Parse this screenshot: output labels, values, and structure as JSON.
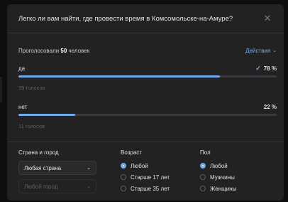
{
  "dialog": {
    "title": "Легко ли вам найти, где провести время в Комсомольске-на-Амуре?",
    "close_icon": "close-icon"
  },
  "summary": {
    "voted_prefix": "Проголосовали",
    "voted_count": "50",
    "voted_suffix": "человек",
    "actions_label": "Действия"
  },
  "options": [
    {
      "label": "да",
      "percent_text": "78 %",
      "percent": 78,
      "votes_text": "39 голосов",
      "selected": true
    },
    {
      "label": "нет",
      "percent_text": "22 %",
      "percent": 22,
      "votes_text": "11 голосов",
      "selected": false
    }
  ],
  "filters": {
    "city": {
      "title": "Страна и город",
      "country_value": "Любая страна",
      "city_value": "Любой город"
    },
    "age": {
      "title": "Возраст",
      "options": [
        "Любой",
        "Старше 17 лет",
        "Старше 35 лет"
      ],
      "selected_index": 0
    },
    "sex": {
      "title": "Пол",
      "options": [
        "Любой",
        "Мужчины",
        "Женщины"
      ],
      "selected_index": 0
    }
  },
  "colors": {
    "accent": "#71aaeb",
    "background": "#222223",
    "muted": "#5e6063"
  }
}
